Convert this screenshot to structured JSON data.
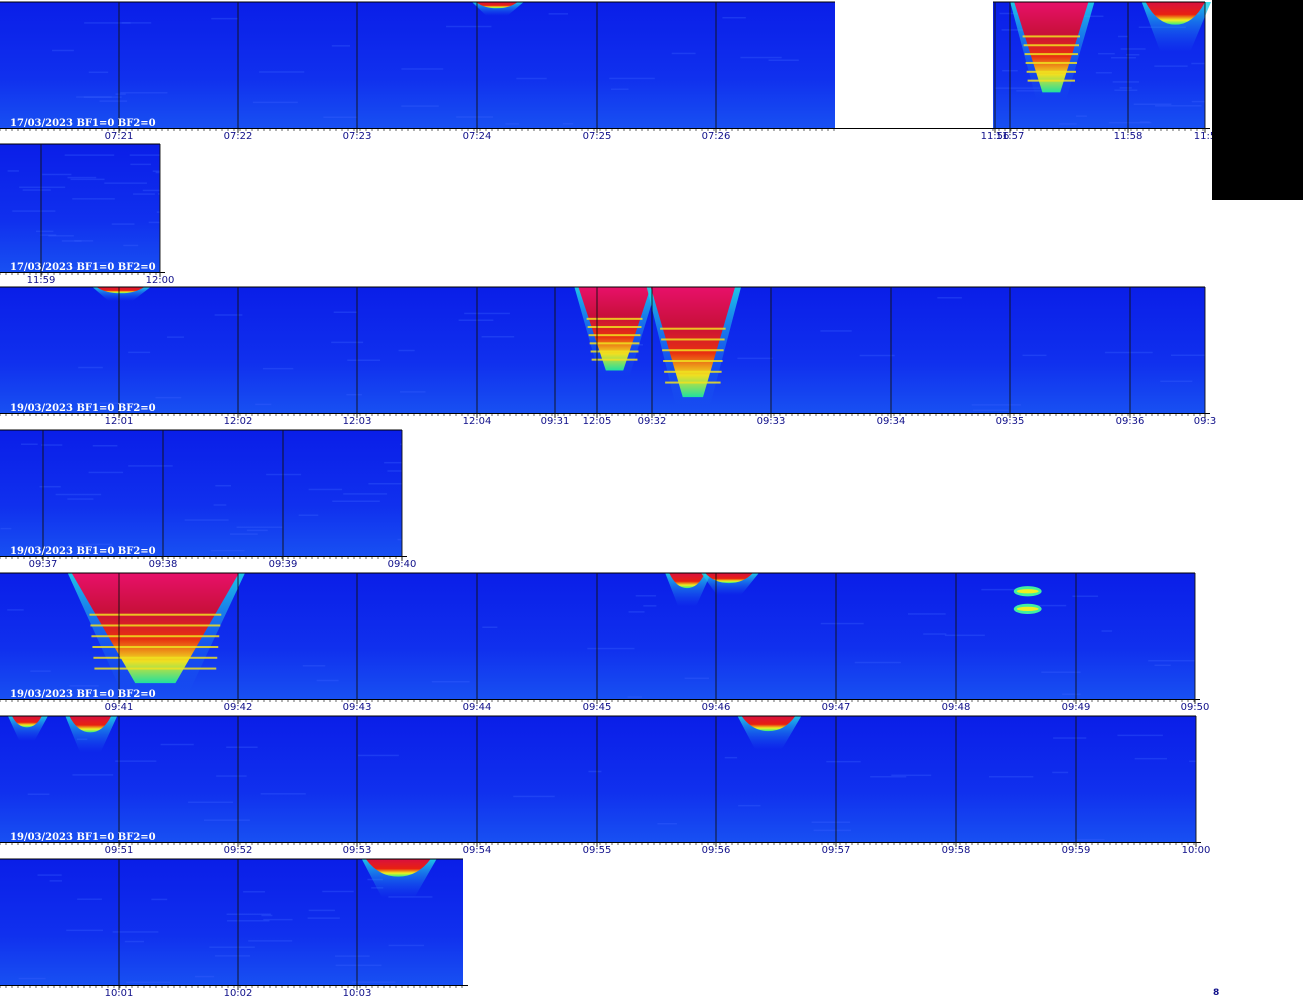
{
  "page_number": "8",
  "chart_data": [
    {
      "type": "heatmap",
      "label": "17/03/2023 BF1=0 BF2=0",
      "x_ticks": [
        "07:21",
        "07:22",
        "07:23",
        "07:24",
        "07:25",
        "07:26"
      ],
      "events": [
        {
          "x": 0.57,
          "y": 0,
          "w": 0.05,
          "depth": 0.05,
          "kind": "blob"
        }
      ]
    },
    {
      "type": "heatmap",
      "label": "",
      "x_ticks": [
        "11:56",
        "11:57",
        "11:58",
        "11:5"
      ],
      "events": [
        {
          "x": 0.1,
          "y": 0,
          "w": 0.35,
          "depth": 0.78,
          "kind": "plume"
        },
        {
          "x": 0.72,
          "y": 0,
          "w": 0.28,
          "depth": 0.18,
          "kind": "blob"
        }
      ]
    },
    {
      "type": "heatmap",
      "label": "17/03/2023 BF1=0 BF2=0",
      "x_ticks": [
        "11:59",
        "12:00"
      ],
      "events": []
    },
    {
      "type": "heatmap",
      "label": "19/03/2023 BF1=0 BF2=0",
      "x_ticks": [
        "12:01",
        "12:02",
        "12:03",
        "12:04",
        "09:31",
        "12:05",
        "09:32",
        "09:33",
        "09:34",
        "09:35",
        "09:36",
        "09:3"
      ],
      "events": [
        {
          "x": 0.08,
          "y": 0,
          "w": 0.04,
          "depth": 0.05,
          "kind": "blob"
        },
        {
          "x": 0.48,
          "y": 0,
          "w": 0.06,
          "depth": 0.72,
          "kind": "plume"
        },
        {
          "x": 0.54,
          "y": 0,
          "w": 0.07,
          "depth": 0.95,
          "kind": "plume"
        }
      ]
    },
    {
      "type": "heatmap",
      "label": "19/03/2023 BF1=0 BF2=0",
      "x_ticks": [
        "09:37",
        "09:38",
        "09:39",
        "09:40"
      ],
      "events": []
    },
    {
      "type": "heatmap",
      "label": "19/03/2023 BF1=0 BF2=0",
      "x_ticks": [
        "09:41",
        "09:42",
        "09:43",
        "09:44",
        "09:45",
        "09:46",
        "09:47",
        "09:48",
        "09:49",
        "09:50"
      ],
      "events": [
        {
          "x": 0.06,
          "y": 0,
          "w": 0.14,
          "depth": 0.95,
          "kind": "plume"
        },
        {
          "x": 0.56,
          "y": 0,
          "w": 0.03,
          "depth": 0.12,
          "kind": "blob"
        },
        {
          "x": 0.59,
          "y": 0,
          "w": 0.04,
          "depth": 0.08,
          "kind": "blob"
        },
        {
          "x": 0.85,
          "y": 0.12,
          "w": 0.02,
          "depth": 0.05,
          "kind": "spot"
        },
        {
          "x": 0.85,
          "y": 0.26,
          "w": 0.02,
          "depth": 0.05,
          "kind": "spot"
        }
      ]
    },
    {
      "type": "heatmap",
      "label": "19/03/2023 BF1=0 BF2=0",
      "x_ticks": [
        "09:51",
        "09:52",
        "09:53",
        "09:54",
        "09:55",
        "09:56",
        "09:57",
        "09:58",
        "09:59",
        "10:00"
      ],
      "events": [
        {
          "x": 0.01,
          "y": 0,
          "w": 0.025,
          "depth": 0.09,
          "kind": "blob"
        },
        {
          "x": 0.058,
          "y": 0,
          "w": 0.035,
          "depth": 0.13,
          "kind": "blob"
        },
        {
          "x": 0.62,
          "y": 0,
          "w": 0.045,
          "depth": 0.12,
          "kind": "blob"
        }
      ]
    },
    {
      "type": "heatmap",
      "label": "",
      "x_ticks": [
        "10:01",
        "10:02",
        "10:03"
      ],
      "events": [
        {
          "x": 0.79,
          "y": 0,
          "w": 0.14,
          "depth": 0.14,
          "kind": "blob"
        }
      ]
    }
  ]
}
